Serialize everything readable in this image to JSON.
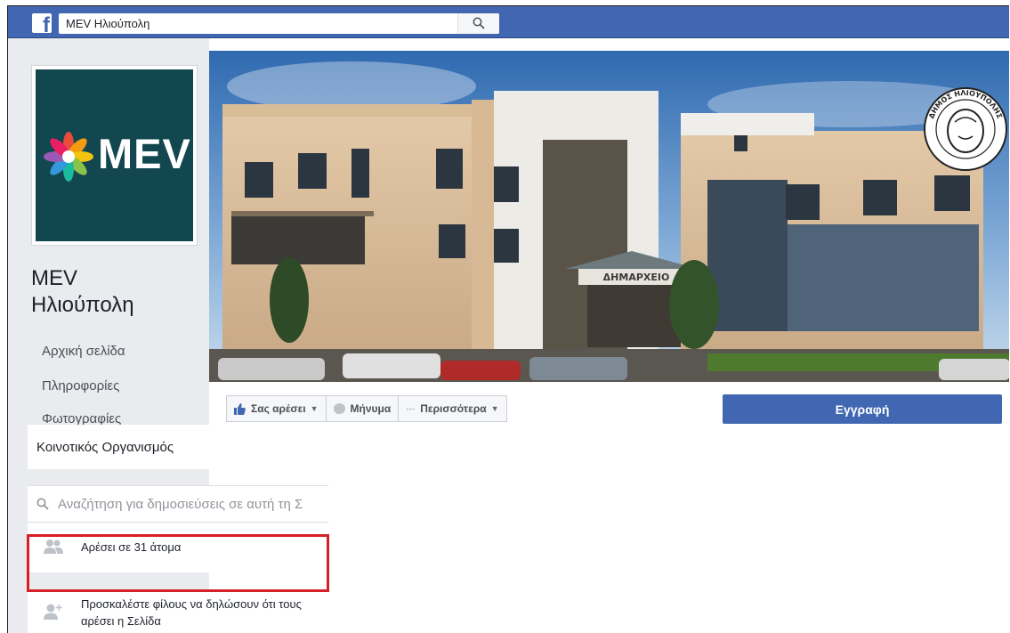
{
  "topbar": {
    "logo_letter": "f",
    "search_value": "MEV Ηλιούπολη",
    "icons": {
      "logo": "facebook-logo",
      "search": "search-icon"
    }
  },
  "profile": {
    "logo_text": "MEV",
    "page_name_line1": "MEV",
    "page_name_line2": "Ηλιούπολη",
    "brand_bg": "#12474f"
  },
  "nav": {
    "items": [
      "Αρχική σελίδα",
      "Πληροφορίες",
      "Φωτογραφίες"
    ],
    "active": "Κοινοτικός Οργανισμός"
  },
  "sidebar": {
    "search_placeholder": "Αναζήτηση για δημοσιεύσεις σε αυτή τη Σ",
    "likes_text": "Αρέσει σε 31 άτομα",
    "invite_text": "Προσκαλέστε φίλους να δηλώσουν ότι τους αρέσει η Σελίδα",
    "icons": {
      "search": "search-icon",
      "likes": "people-icon",
      "invite": "add-friend-icon"
    }
  },
  "cover": {
    "building_sign": "ΔΗΜΑΡΧΕΙΟ",
    "seal_text": "ΔΗΜΟΣ ΗΛΙΟΥΠΟΛΗΣ"
  },
  "actions": {
    "like_label": "Σας αρέσει",
    "message_label": "Μήνυμα",
    "more_label": "Περισσότερα",
    "signup_label": "Εγγραφή",
    "icons": {
      "like": "thumbs-up-icon",
      "message": "messenger-icon",
      "more": "more-dots-icon",
      "caret": "caret-down-icon"
    }
  },
  "colors": {
    "fb_blue": "#4267b2",
    "highlight_red": "#d61f26",
    "sidebar_bg": "#e9ebee"
  }
}
